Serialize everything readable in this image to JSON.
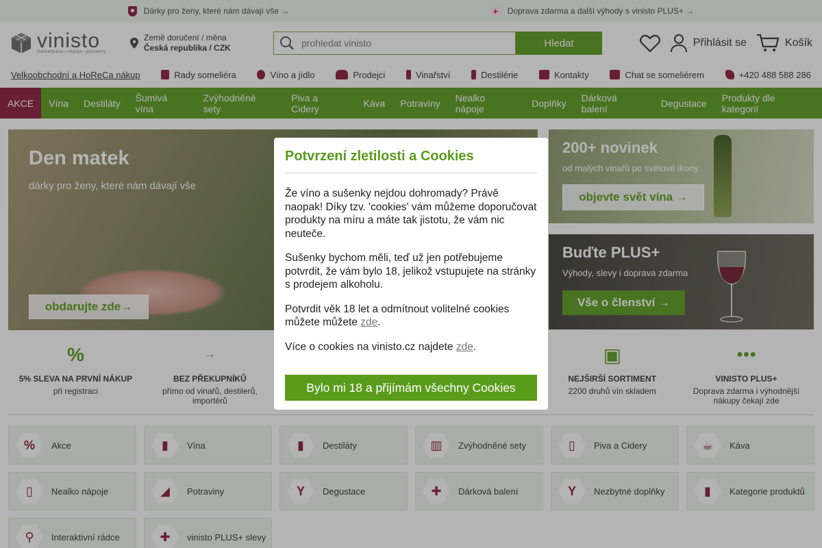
{
  "promo": {
    "left": "Dárky pro ženy, které nám dávají vše →",
    "right": "Doprava zdarma a další výhody s vinisto PLUS+ →"
  },
  "header": {
    "logo": "vinisto",
    "logo_sub": "marketplace—nápoje—potraviny",
    "delivery_label": "Země doručení / měna",
    "delivery_value": "Česká republika / CZK",
    "search_placeholder": "prohledat vinisto",
    "search_button": "Hledat",
    "login": "Přihlásit se",
    "cart": "Košík"
  },
  "subnav": [
    {
      "label": "Velkoobchodní a HoReCa nákup",
      "icon": "none"
    },
    {
      "label": "Rady someliéra",
      "icon": "sommelier-icon"
    },
    {
      "label": "Víno a jídlo",
      "icon": "grapes-icon"
    },
    {
      "label": "Prodejci",
      "icon": "people-icon"
    },
    {
      "label": "Vinařství",
      "icon": "bottle-icon"
    },
    {
      "label": "Destilérie",
      "icon": "bottle-icon"
    },
    {
      "label": "Kontakty",
      "icon": "contacts-icon"
    },
    {
      "label": "Chat se someliérem",
      "icon": "chat-icon"
    },
    {
      "label": "+420 488 588 286",
      "icon": "phone-icon"
    }
  ],
  "mainnav": [
    "AKCE",
    "Vína",
    "Destiláty",
    "Šumivá vína",
    "Zvýhodněné sety",
    "Piva a Cidery",
    "Káva",
    "Potraviny",
    "Nealko nápoje",
    "Doplňky",
    "Dárková balení",
    "Degustace",
    "Produkty dle kategorií"
  ],
  "hero": {
    "title": "Den matek",
    "subtitle": "dárky pro ženy, které nám dávají vše",
    "cta": "obdarujte zde→"
  },
  "side1": {
    "title": "200+ novinek",
    "text": "od malých vinařů po světové ikony",
    "cta": "objevte svět vína →"
  },
  "side2": {
    "title": "Buďte PLUS+",
    "text": "Výhody, slevy i doprava zdarma",
    "cta": "Vše o členství →"
  },
  "usp": [
    {
      "title": "5% SLEVA NA PRVNÍ NÁKUP",
      "text": "při registraci",
      "icon": "%"
    },
    {
      "title": "BEZ PŘEKUPNÍKŮ",
      "text": "přímo od vinařů, destilerů, importérů",
      "icon": "→"
    },
    {
      "title": "",
      "text": "",
      "icon": ""
    },
    {
      "title": "",
      "text": "",
      "icon": ""
    },
    {
      "title": "NEJŠIRŠÍ SORTIMENT",
      "text": "2200 druhů vín skladem",
      "icon": "▣"
    },
    {
      "title": "VINISTO PLUS+",
      "text": "Doprava zdarma i výhodnější nákupy čekají zde",
      "icon": "●●●"
    }
  ],
  "categories": [
    {
      "label": "Akce",
      "icon": "%"
    },
    {
      "label": "Vína",
      "icon": "▮"
    },
    {
      "label": "Destiláty",
      "icon": "▮"
    },
    {
      "label": "Zvýhodněné sety",
      "icon": "▥"
    },
    {
      "label": "Piva a Cidery",
      "icon": "▯"
    },
    {
      "label": "Káva",
      "icon": "☕"
    },
    {
      "label": "Nealko nápoje",
      "icon": "▯"
    },
    {
      "label": "Potraviny",
      "icon": "◢"
    },
    {
      "label": "Degustace",
      "icon": "Y"
    },
    {
      "label": "Dárková balení",
      "icon": "✚"
    },
    {
      "label": "Nezbytné doplňky",
      "icon": "Y"
    },
    {
      "label": "Kategorie produktů",
      "icon": "▮"
    },
    {
      "label": "Interaktivní rádce",
      "icon": "⚲"
    },
    {
      "label": "vinisto PLUS+ slevy",
      "icon": "✚"
    }
  ],
  "modal": {
    "title": "Potvrzení zletilosti a Cookies",
    "p1": "Že víno a sušenky nejdou dohromady? Právě naopak! Díky tzv. 'cookies' vám můžeme doporučovat produkty na míru a máte tak jistotu, že vám nic neuteče.",
    "p2": "Sušenky bychom měli, teď už jen potřebujeme potvrdit, že vám bylo 18, jelikož vstupujete na stránky s prodejem alkoholu.",
    "p3": "Potvrdit věk 18 let a odmítnout volitelné cookies můžete můžete ",
    "p3_link": "zde",
    "p4": "Více o cookies na vinisto.cz najdete ",
    "p4_link": "zde",
    "accept": "Bylo mi 18 a přijímám všechny Cookies"
  },
  "colors": {
    "brand_green": "#5a9b1c",
    "brand_wine": "#8b1b3c"
  }
}
